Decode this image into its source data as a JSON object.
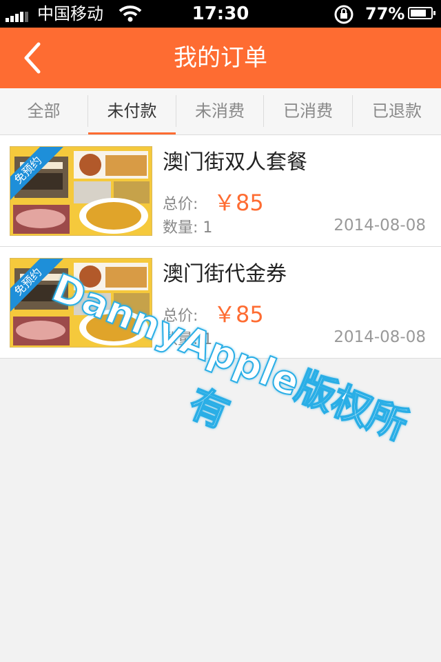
{
  "status_bar": {
    "carrier": "中国移动",
    "time": "17:30",
    "battery": "77%",
    "battery_level": 0.77
  },
  "navbar": {
    "title": "我的订单"
  },
  "tabs": [
    {
      "label": "全部",
      "active": false
    },
    {
      "label": "未付款",
      "active": true
    },
    {
      "label": "未消费",
      "active": false
    },
    {
      "label": "已消费",
      "active": false
    },
    {
      "label": "已退款",
      "active": false
    }
  ],
  "orders": [
    {
      "badge": "免预约",
      "name": "澳门街双人套餐",
      "price_label": "总价:",
      "price": "￥85",
      "qty_label": "数量: 1",
      "date": "2014-08-08"
    },
    {
      "badge": "免预约",
      "name": "澳门街代金券",
      "price_label": "总价:",
      "price": "￥85",
      "qty_label": "数量: 1",
      "date": "2014-08-08"
    }
  ],
  "watermark": "DannyApple版权所有",
  "colors": {
    "accent": "#fe6c32",
    "badge": "#1e8fd9"
  }
}
